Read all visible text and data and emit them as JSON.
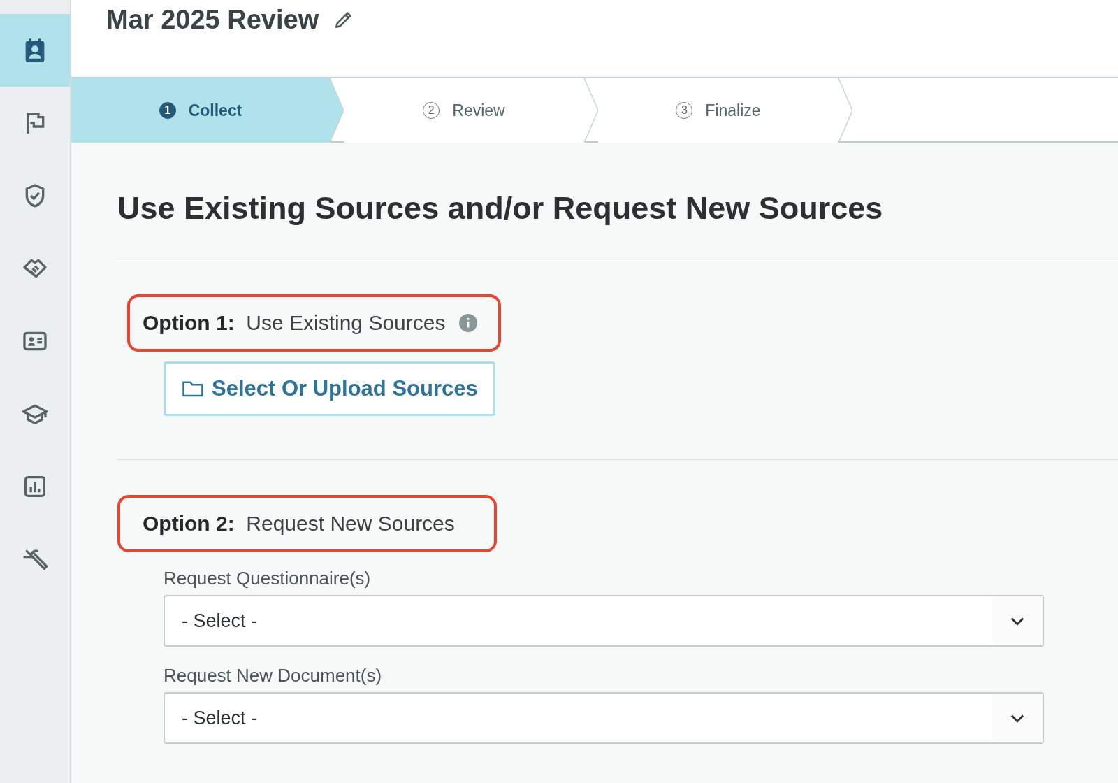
{
  "sidebar": {
    "items": [
      {
        "selected": true
      },
      {
        "selected": false
      },
      {
        "selected": false
      },
      {
        "selected": false
      },
      {
        "selected": false
      },
      {
        "selected": false
      },
      {
        "selected": false
      },
      {
        "selected": false
      }
    ]
  },
  "header": {
    "title": "Mar 2025 Review"
  },
  "steps": [
    {
      "number": "1",
      "label": "Collect",
      "selected": true
    },
    {
      "number": "2",
      "label": "Review",
      "selected": false
    },
    {
      "number": "3",
      "label": "Finalize",
      "selected": false
    }
  ],
  "page_heading": "Use Existing Sources and/or Request New Sources",
  "options": [
    {
      "heading": "**Option 1:**  Use Existing Sources",
      "info": true,
      "button": "Select Or Upload Sources"
    },
    {
      "heading": "**Option 2:**  Request New Sources",
      "info": false,
      "fields": [
        {
          "label": "Request Questionnaire(s)",
          "value": "- Select -"
        },
        {
          "label": "Request New Document(s)",
          "value": "- Select -"
        }
      ]
    }
  ]
}
